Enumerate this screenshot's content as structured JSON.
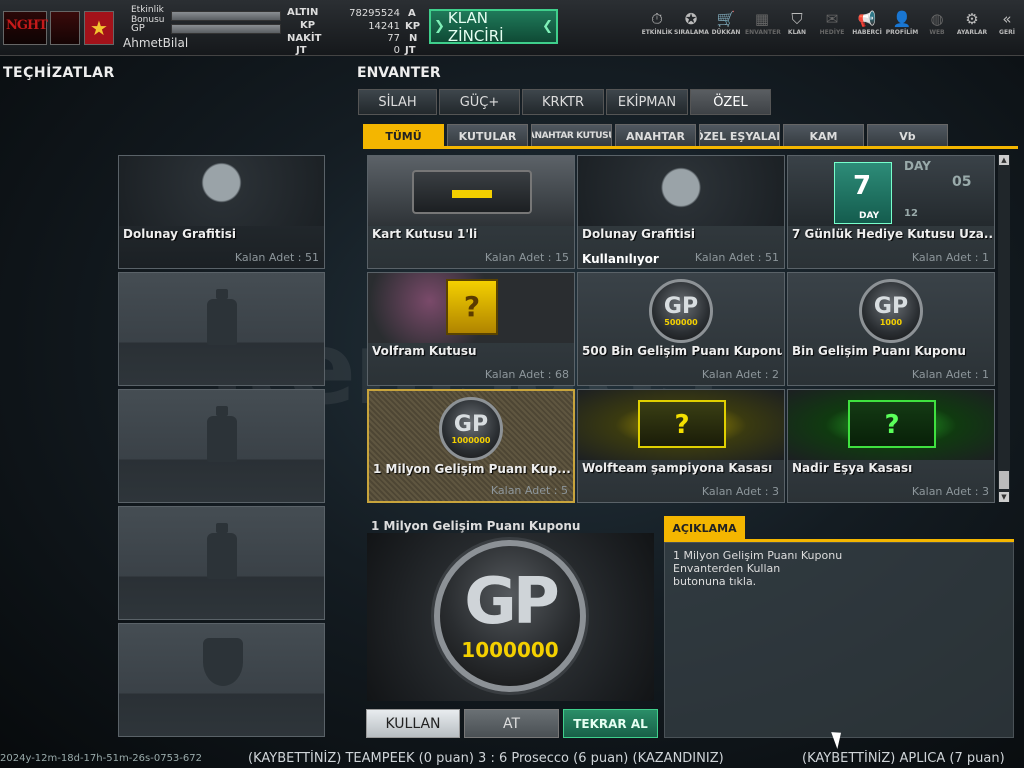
{
  "topbar": {
    "logo_text": "NGHT",
    "bonus_label": "Etkinlik Bonusu",
    "gp_label": "GP",
    "username": "AhmetBilal",
    "currencies": [
      {
        "name": "ALTIN",
        "value": "78295524",
        "unit": "A"
      },
      {
        "name": "KP",
        "value": "14241",
        "unit": "KP"
      },
      {
        "name": "NAKİT",
        "value": "77",
        "unit": "N"
      },
      {
        "name": "JT",
        "value": "0",
        "unit": "JT"
      }
    ],
    "klan_button": "KLAN ZİNCİRİ",
    "nav": [
      {
        "label": "ETKİNLİK",
        "icon": "stopwatch-icon"
      },
      {
        "label": "SIRALAMA",
        "icon": "rank-medal-icon"
      },
      {
        "label": "DÜKKAN",
        "icon": "cart-icon"
      },
      {
        "label": "ENVANTER",
        "icon": "inventory-icon"
      },
      {
        "label": "KLAN",
        "icon": "clan-shield-icon"
      },
      {
        "label": "HEDİYE",
        "icon": "gift-icon"
      },
      {
        "label": "HABERCİ",
        "icon": "megaphone-icon"
      },
      {
        "label": "PROFİLİM",
        "icon": "profile-icon"
      },
      {
        "label": "WEB",
        "icon": "globe-icon"
      },
      {
        "label": "AYARLAR",
        "icon": "gear-icon"
      },
      {
        "label": "GERİ",
        "icon": "back-chevron-icon"
      }
    ]
  },
  "left": {
    "title": "TEÇHİZATLAR",
    "slot0": {
      "name": "Dolunay Grafitisi",
      "count": "Kalan Adet : 51"
    }
  },
  "inventory": {
    "title": "ENVANTER",
    "tabs": [
      "SİLAH",
      "GÜÇ+",
      "KRKTR",
      "EKİPMAN",
      "ÖZEL"
    ],
    "subtabs": [
      "TÜMÜ",
      "KUTULAR",
      "ANAHTAR KUTUSU",
      "ANAHTAR",
      "ÖZEL EŞYALAR",
      "KAM",
      "Vb"
    ],
    "items": [
      {
        "name": "Kart Kutusu 1'li",
        "count": "Kalan Adet : 15"
      },
      {
        "name": "Dolunay Grafitisi",
        "count": "Kalan Adet : 51",
        "status": "Kullanılıyor"
      },
      {
        "name": "7 Günlük Hediye Kutusu Uza...",
        "count": "Kalan Adet : 1",
        "img_day": "DAY",
        "img_num": "7",
        "img_05": "05",
        "img_12": "12"
      },
      {
        "name": "Volfram Kutusu",
        "count": "Kalan Adet : 68"
      },
      {
        "name": "500 Bin Gelişim Puanı Kuponu",
        "count": "Kalan Adet : 2",
        "coin_label": "GP",
        "coin_value": "500000"
      },
      {
        "name": "Bin Gelişim Puanı Kuponu",
        "count": "Kalan Adet : 1",
        "coin_label": "GP",
        "coin_value": "1000"
      },
      {
        "name": "1 Milyon Gelişim Puanı Kup...",
        "count": "Kalan Adet : 5",
        "coin_label": "GP",
        "coin_value": "1000000"
      },
      {
        "name": "Wolfteam şampiyona Kasası",
        "count": "Kalan Adet : 3"
      },
      {
        "name": "Nadir Eşya Kasası",
        "count": "Kalan Adet : 3"
      }
    ]
  },
  "detail": {
    "name": "1 Milyon Gelişim Puanı Kuponu",
    "coin_label": "GP",
    "coin_value": "1000000",
    "buttons": {
      "use": "KULLAN",
      "drop": "AT",
      "rebuy": "TEKRAR AL"
    }
  },
  "description": {
    "title": "AÇIKLAMA",
    "lines": [
      "1 Milyon Gelişim Puanı Kuponu",
      "Envanterden Kullan",
      "butonuna tıkla."
    ]
  },
  "ticker": {
    "text1": "(KAYBETTİNİZ) TEAMPEEK (0 puan) 3 : 6 Prosecco (6 puan) (KAZANDINIZ)",
    "text2": "(KAYBETTİNİZ) APLICA (7 puan)",
    "timestamp": "2024y-12m-18d-17h-51m-26s-0753-672"
  },
  "watermark": "itemsatis"
}
